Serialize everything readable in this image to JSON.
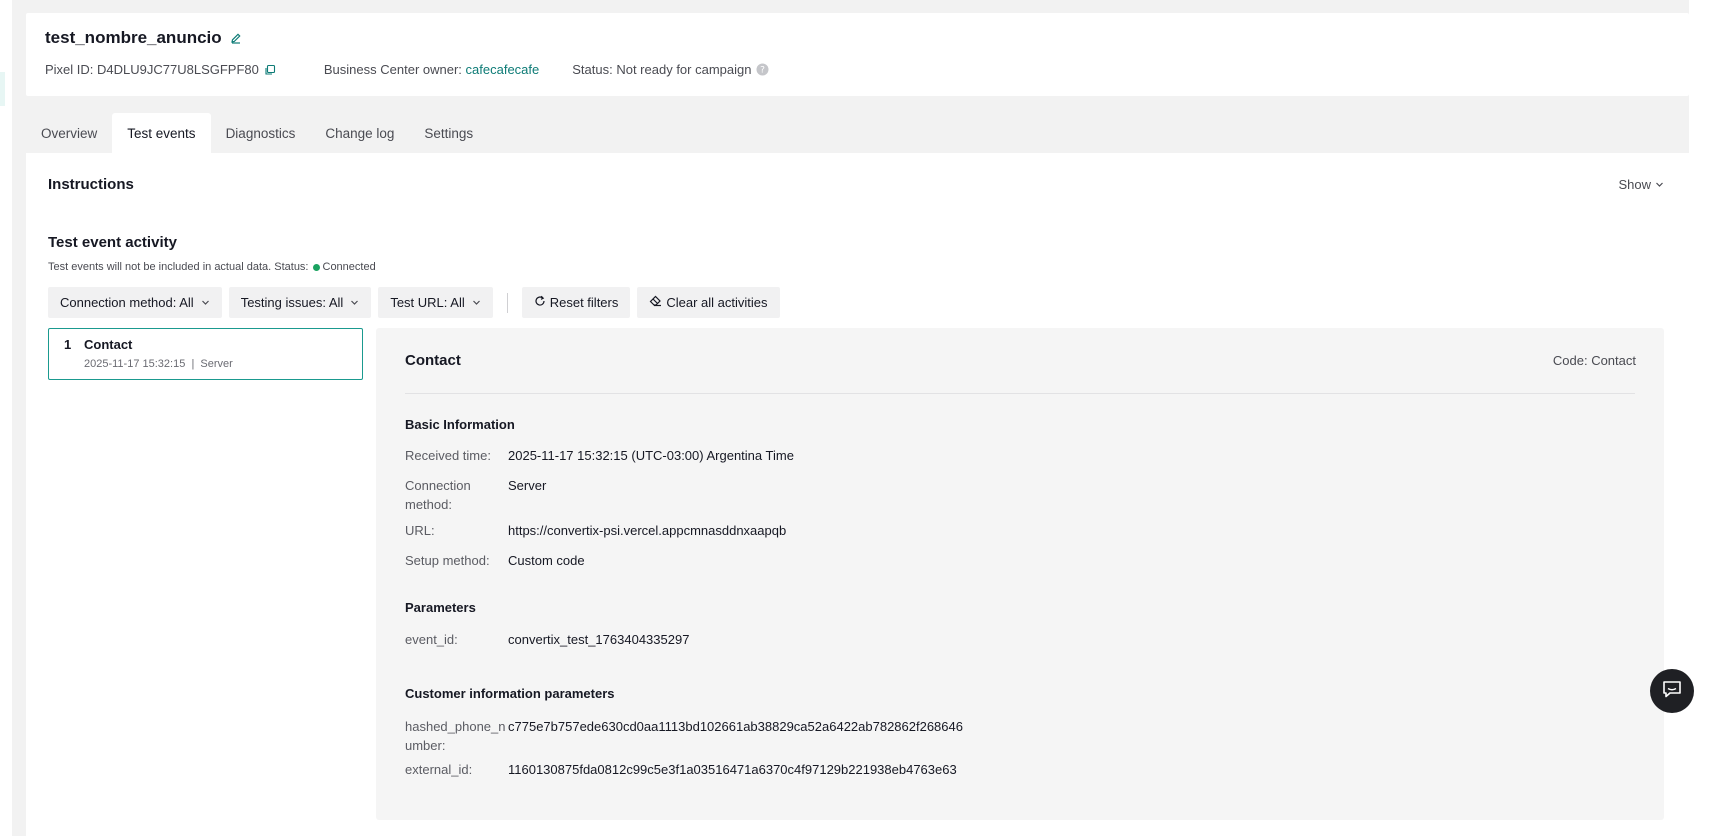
{
  "header": {
    "title": "test_nombre_anuncio",
    "pixel_id_label": "Pixel ID:",
    "pixel_id": "D4DLU9JC77U8LSGFPF80",
    "owner_label": "Business Center owner:",
    "owner": "cafecafecafe",
    "status_label": "Status:",
    "status": "Not ready for campaign"
  },
  "tabs": [
    {
      "label": "Overview",
      "active": false
    },
    {
      "label": "Test events",
      "active": true
    },
    {
      "label": "Diagnostics",
      "active": false
    },
    {
      "label": "Change log",
      "active": false
    },
    {
      "label": "Settings",
      "active": false
    }
  ],
  "instructions": {
    "title": "Instructions",
    "toggle": "Show"
  },
  "activity": {
    "title": "Test event activity",
    "subtitle": "Test events will not be included in actual data. Status:",
    "status": "Connected",
    "status_color": "#1aa260"
  },
  "filters": {
    "connection_method": "Connection method: All",
    "testing_issues": "Testing issues: All",
    "test_url": "Test URL: All",
    "reset": "Reset filters",
    "clear": "Clear all activities"
  },
  "events": [
    {
      "index": "1",
      "name": "Contact",
      "meta": "2025-11-17 15:32:15  |  Server"
    }
  ],
  "detail": {
    "title": "Contact",
    "code": "Code: Contact",
    "basic_title": "Basic Information",
    "basic": {
      "received_label": "Received time:",
      "received_value": "2025-11-17 15:32:15 (UTC-03:00) Argentina Time",
      "connection_label_1": "Connection",
      "connection_label_2": "method:",
      "connection_value": "Server",
      "url_label": "URL:",
      "url_value": "https://convertix-psi.vercel.appcmnasddnxaapqb",
      "setup_label": "Setup method:",
      "setup_value": "Custom code"
    },
    "params_title": "Parameters",
    "params": {
      "event_id_label": "event_id:",
      "event_id_value": "convertix_test_1763404335297"
    },
    "customer_title": "Customer information parameters",
    "customer": {
      "phone_label_1": "hashed_phone_n",
      "phone_label_2": "umber:",
      "phone_value": "c775e7b757ede630cd0aa1113bd102661ab38829ca52a6422ab782862f268646",
      "external_label": "external_id:",
      "external_value": "1160130875fda0812c99c5e3f1a03516471a6370c4f97129b221938eb4763e63"
    }
  },
  "colors": {
    "accent": "#0d7b76",
    "selected_border": "#1a9a8f",
    "chat_button": "#1f2024"
  },
  "icons": [
    "edit-icon",
    "copy-icon",
    "help-icon",
    "chevron-down-icon",
    "refresh-icon",
    "eraser-icon",
    "chat-icon"
  ]
}
